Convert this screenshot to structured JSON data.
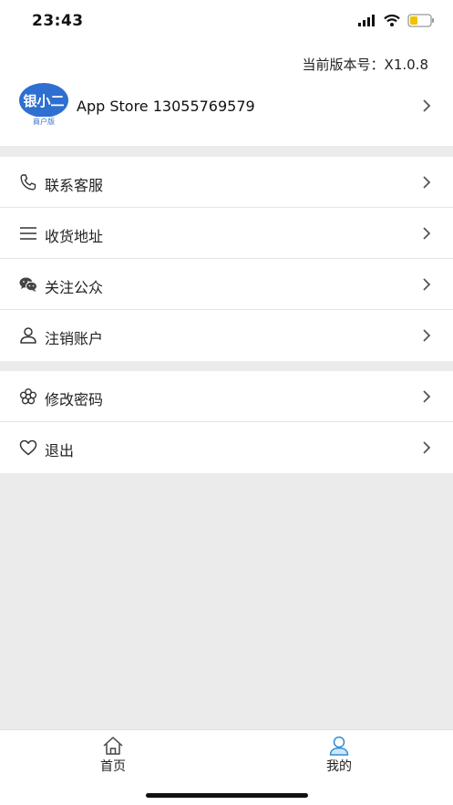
{
  "status_bar": {
    "time": "23:43",
    "icons": [
      "signal-icon",
      "wifi-icon",
      "battery-icon"
    ],
    "battery_color": "#f2c200"
  },
  "profile": {
    "version": "当前版本号：X1.0.8",
    "logo": {
      "main_text": "银小二",
      "sub_text": "商户版",
      "brand_color": "#2e6fd1"
    },
    "account": "App Store 13055769579"
  },
  "menu_group_1": [
    {
      "label": "联系客服",
      "icon": "phone-icon"
    },
    {
      "label": "收货地址",
      "icon": "list-icon"
    },
    {
      "label": "关注公众",
      "icon": "wechat-icon"
    },
    {
      "label": "注销账户",
      "icon": "user-icon"
    }
  ],
  "menu_group_2": [
    {
      "label": "修改密码",
      "icon": "flower-icon"
    },
    {
      "label": "退出",
      "icon": "heart-icon"
    }
  ],
  "tabbar": {
    "tabs": [
      {
        "label": "首页",
        "icon": "home-icon",
        "active": false
      },
      {
        "label": "我的",
        "icon": "profile-icon",
        "active": true
      }
    ],
    "active_color": "#2e8bd8"
  }
}
